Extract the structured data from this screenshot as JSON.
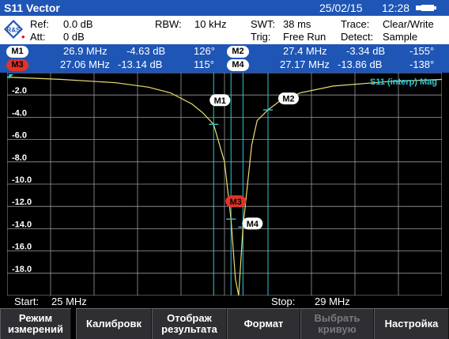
{
  "title_bar": {
    "title": "S11 Vector",
    "date": "25/02/15",
    "time": "12:28"
  },
  "settings": {
    "ref_label": "Ref:",
    "ref_value": "0.0 dB",
    "att_label": "Att:",
    "att_value": "0 dB",
    "rbw_label": "RBW:",
    "rbw_value": "10 kHz",
    "swt_label": "SWT:",
    "swt_value": "38 ms",
    "trig_label": "Trig:",
    "trig_value": "Free Run",
    "trace_label": "Trace:",
    "trace_value": "Clear/Write",
    "detect_label": "Detect:",
    "detect_value": "Sample"
  },
  "markers": [
    {
      "id": "M1",
      "freq": "26.9 MHz",
      "level": "-4.63 dB",
      "phase": "126°",
      "style": "white"
    },
    {
      "id": "M2",
      "freq": "27.4 MHz",
      "level": "-3.34 dB",
      "phase": "-155°",
      "style": "white"
    },
    {
      "id": "M3",
      "freq": "27.06 MHz",
      "level": "-13.14 dB",
      "phase": "115°",
      "style": "red"
    },
    {
      "id": "M4",
      "freq": "27.17 MHz",
      "level": "-13.86 dB",
      "phase": "-138°",
      "style": "white"
    }
  ],
  "chart_data": {
    "type": "line",
    "title": "S11 (interp) Mag",
    "x_start": 25,
    "x_stop": 29,
    "x_unit": "MHz",
    "y_range": [
      -20,
      0
    ],
    "y_ticks": [
      "-2.0",
      "-4.0",
      "-6.0",
      "-8.0",
      "-10.0",
      "-12.0",
      "-14.0",
      "-16.0",
      "-18.0"
    ],
    "y_tick_values": [
      -2,
      -4,
      -6,
      -8,
      -10,
      -12,
      -14,
      -16,
      -18
    ],
    "grid": true,
    "x_grid_divisions": 10,
    "series": [
      {
        "color": "#e8e070",
        "x": [
          25.0,
          25.5,
          26.0,
          26.3,
          26.5,
          26.7,
          26.8,
          26.9,
          27.0,
          27.06,
          27.1,
          27.13,
          27.17,
          27.25,
          27.3,
          27.4,
          27.5,
          27.7,
          28.0,
          28.5,
          29.0
        ],
        "y": [
          -0.4,
          -0.6,
          -0.9,
          -1.3,
          -1.8,
          -2.8,
          -3.6,
          -4.63,
          -8.0,
          -13.14,
          -18.5,
          -20.0,
          -13.86,
          -6.5,
          -4.3,
          -3.34,
          -2.6,
          -1.8,
          -1.2,
          -0.8,
          -0.6
        ]
      }
    ],
    "marker_points": [
      {
        "id": "M1",
        "x": 26.9,
        "y": -4.63
      },
      {
        "id": "M2",
        "x": 27.4,
        "y": -3.34
      },
      {
        "id": "M3",
        "x": 27.06,
        "y": -13.14
      },
      {
        "id": "M4",
        "x": 27.17,
        "y": -13.86
      }
    ],
    "start_label": "Start:",
    "start_value": "25 MHz",
    "stop_label": "Stop:",
    "stop_value": "29 MHz"
  },
  "softkeys": [
    {
      "label": "Режим\nизмерений",
      "enabled": true
    },
    {
      "label": "Калибровк",
      "enabled": true
    },
    {
      "label": "Отображ\nрезультата",
      "enabled": true
    },
    {
      "label": "Формат",
      "enabled": true
    },
    {
      "label": "Выбрать\nкривую",
      "enabled": false
    },
    {
      "label": "Настройка",
      "enabled": true
    }
  ],
  "colors": {
    "header_blue": "#1f55b4",
    "trace": "#e8e070",
    "marker_line": "#33c6d8",
    "marker_red": "#e0342b",
    "grid": "#9a9aa0",
    "label_cyan": "#33c6d8"
  }
}
